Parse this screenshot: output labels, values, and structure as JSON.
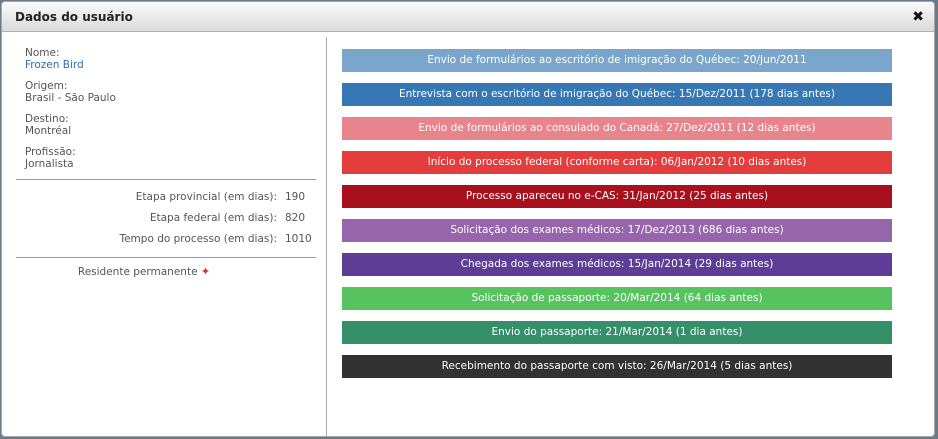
{
  "dialog": {
    "title": "Dados do usuário"
  },
  "profile": {
    "name_label": "Nome:",
    "name_value": "Frozen Bird",
    "origin_label": "Origem:",
    "origin_value": "Brasil - São Paulo",
    "dest_label": "Destino:",
    "dest_value": "Montréal",
    "prof_label": "Profissão:",
    "prof_value": "Jornalista"
  },
  "stats": [
    {
      "label": "Etapa provincial (em dias):",
      "value": "190"
    },
    {
      "label": "Etapa federal (em dias):",
      "value": "820"
    },
    {
      "label": "Tempo do processo (em dias):",
      "value": "1010"
    }
  ],
  "status": {
    "label": "Residente permanente",
    "icon": "maple-leaf-icon"
  },
  "colors": {
    "step1": "#7aa6cc",
    "step2": "#3677b4",
    "step3": "#e8848c",
    "step4": "#e43d3d",
    "step5": "#a8101d",
    "step6": "#9665ac",
    "step7": "#5e3d96",
    "step8": "#57c35f",
    "step9": "#35906a",
    "step10": "#323232"
  },
  "timeline": [
    "Envio de formulários ao escritório de imigração do Québec: 20/Jun/2011",
    "Entrevista com o escritório de imigração do Québec: 15/Dez/2011 (178 dias antes)",
    "Envio de formulários ao consulado do Canadá: 27/Dez/2011 (12 dias antes)",
    "Início do processo federal (conforme carta): 06/Jan/2012 (10 dias antes)",
    "Processo apareceu no e-CAS: 31/Jan/2012 (25 dias antes)",
    "Solicitação dos exames médicos: 17/Dez/2013 (686 dias antes)",
    "Chegada dos exames médicos: 15/Jan/2014 (29 dias antes)",
    "Solicitação de passaporte: 20/Mar/2014 (64 dias antes)",
    "Envio do passaporte: 21/Mar/2014 (1 dia antes)",
    "Recebimento do passaporte com visto: 26/Mar/2014 (5 dias antes)"
  ]
}
